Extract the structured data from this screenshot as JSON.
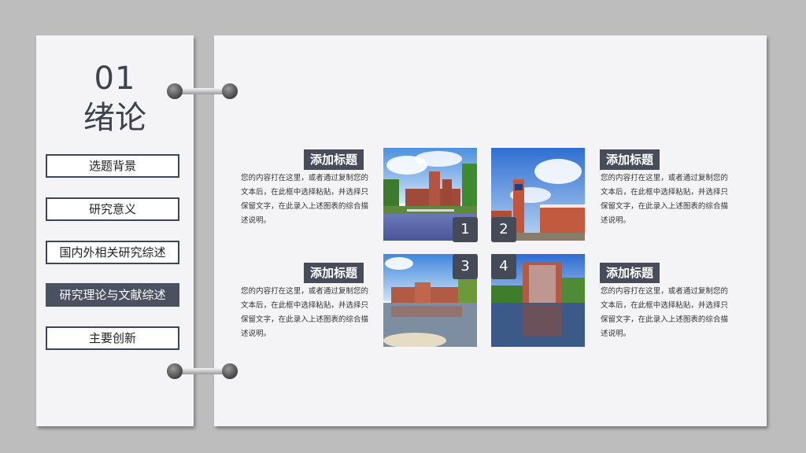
{
  "section": {
    "number": "01",
    "title": "绪论"
  },
  "menu": [
    {
      "label": "选题背景",
      "active": false
    },
    {
      "label": "研究意义",
      "active": false
    },
    {
      "label": "国内外相关研究综述",
      "active": false
    },
    {
      "label": "研究理论与文献综述",
      "active": true
    },
    {
      "label": "主要创新",
      "active": false
    }
  ],
  "blocks": [
    {
      "title": "添加标题",
      "text": "您的内容打在这里，或者通过复制您的文本后，在此框中选择粘贴，并选择只保留文字，在此录入上述图表的综合描述说明。"
    },
    {
      "title": "添加标题",
      "text": "您的内容打在这里，或者通过复制您的文本后，在此框中选择粘贴，并选择只保留文字，在此录入上述图表的综合描述说明。"
    },
    {
      "title": "添加标题",
      "text": "您的内容打在这里，或者通过复制您的文本后，在此框中选择粘贴，并选择只保留文字，在此录入上述图表的综合描述说明。"
    },
    {
      "title": "添加标题",
      "text": "您的内容打在这里，或者通过复制您的文本后，在此框中选择粘贴，并选择只保留文字，在此录入上述图表的综合描述说明。"
    }
  ],
  "badges": [
    "1",
    "2",
    "3",
    "4"
  ],
  "colors": {
    "dark": "#464c5a",
    "card": "#f4f4f6",
    "background": "#bdbdbd"
  }
}
